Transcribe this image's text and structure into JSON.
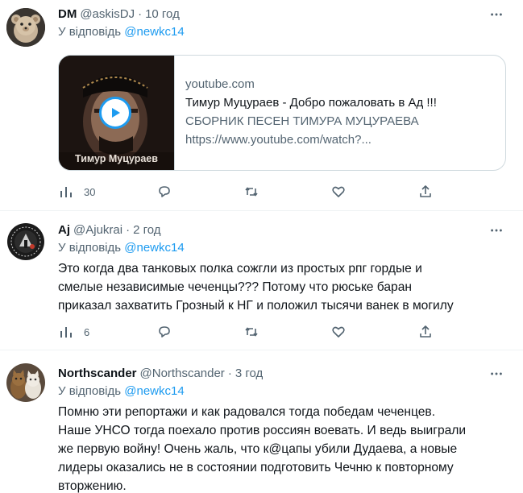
{
  "tweets": [
    {
      "name": "DM",
      "handle": "@askisDJ",
      "time": "10 год",
      "reply_prefix": "У відповідь",
      "reply_to": "@newkc14",
      "card": {
        "domain": "youtube.com",
        "title": "Тимур Муцураев - Добро пожаловать в Ад !!!",
        "description": "СБОРНИК ПЕСЕН ТИМУРА МУЦУРАЕВА",
        "url": "https://www.youtube.com/watch?...",
        "thumb_caption": "Тимур Муцураев"
      },
      "views": "30"
    },
    {
      "name": "Aj",
      "handle": "@Ajukrai",
      "time": "2 год",
      "reply_prefix": "У відповідь",
      "reply_to": "@newkc14",
      "text_lines": [
        "Это когда два танковых полка сожгли из простых рпг гордые и",
        "смелые независимые чеченцы??? Потому что рюськe баран",
        "приказал захватить Грозный к НГ и положил тысячи ванек в могилу"
      ],
      "views": "6"
    },
    {
      "name": "Northscander",
      "handle": "@Northscander",
      "time": "3 год",
      "reply_prefix": "У відповідь",
      "reply_to": "@newkc14",
      "text_lines": [
        "Помню эти репортажи и как радовался тогда победам чеченцев.",
        "Наше УНСО тогда поехало против россиян воевать. И ведь выиграли",
        "же первую войну! Очень жаль, что к@цапы убили Дудаева, а новые",
        "лидеры оказались не в состоянии подготовить Чечню к повторному",
        "вторжению."
      ]
    }
  ],
  "colors": {
    "text": "#0f1419",
    "secondary": "#536471",
    "link": "#1d9bf0",
    "border": "#cfd9de",
    "divider": "#eff3f4"
  },
  "icons": [
    "more-icon",
    "views-icon",
    "reply-icon",
    "retweet-icon",
    "like-icon",
    "share-icon",
    "play-icon"
  ]
}
